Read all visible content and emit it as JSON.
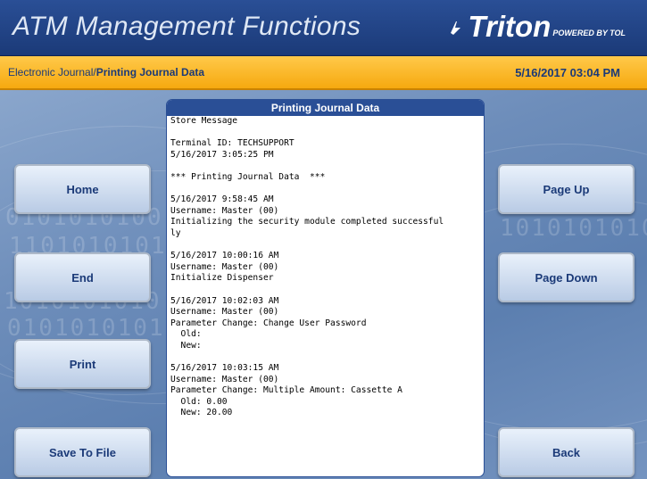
{
  "header": {
    "title": "ATM Management Functions",
    "brand": "Triton",
    "brand_tagline": "POWERED BY TOL"
  },
  "subbar": {
    "breadcrumb_parent": "Electronic Journal/",
    "breadcrumb_current": "Printing Journal Data",
    "datetime": "5/16/2017  03:04 PM"
  },
  "left_buttons": [
    "Home",
    "End",
    "Print",
    "Save To File"
  ],
  "right_buttons": [
    "Page Up",
    "Page Down",
    "Back"
  ],
  "panel": {
    "title": "Printing Journal Data",
    "lines": [
      "Store Message",
      "",
      "Terminal ID: TECHSUPPORT",
      "5/16/2017 3:05:25 PM",
      "",
      "*** Printing Journal Data  ***",
      "",
      "5/16/2017 9:58:45 AM",
      "Username: Master (00)",
      "Initializing the security module completed successful",
      "ly",
      "",
      "5/16/2017 10:00:16 AM",
      "Username: Master (00)",
      "Initialize Dispenser",
      "",
      "5/16/2017 10:02:03 AM",
      "Username: Master (00)",
      "Parameter Change: Change User Password",
      "  Old:",
      "  New:",
      "",
      "5/16/2017 10:03:15 AM",
      "Username: Master (00)",
      "Parameter Change: Multiple Amount: Cassette A",
      "  Old: 0.00",
      "  New: 20.00"
    ]
  },
  "background": {
    "binary_rows": [
      "0101010100",
      "1101010101",
      "1010101010",
      "0101010101",
      "1010101010"
    ]
  },
  "colors": {
    "header_blue": "#1b3a78",
    "accent_orange": "#f6a90f",
    "panel_title_bg": "#2a4f96"
  }
}
